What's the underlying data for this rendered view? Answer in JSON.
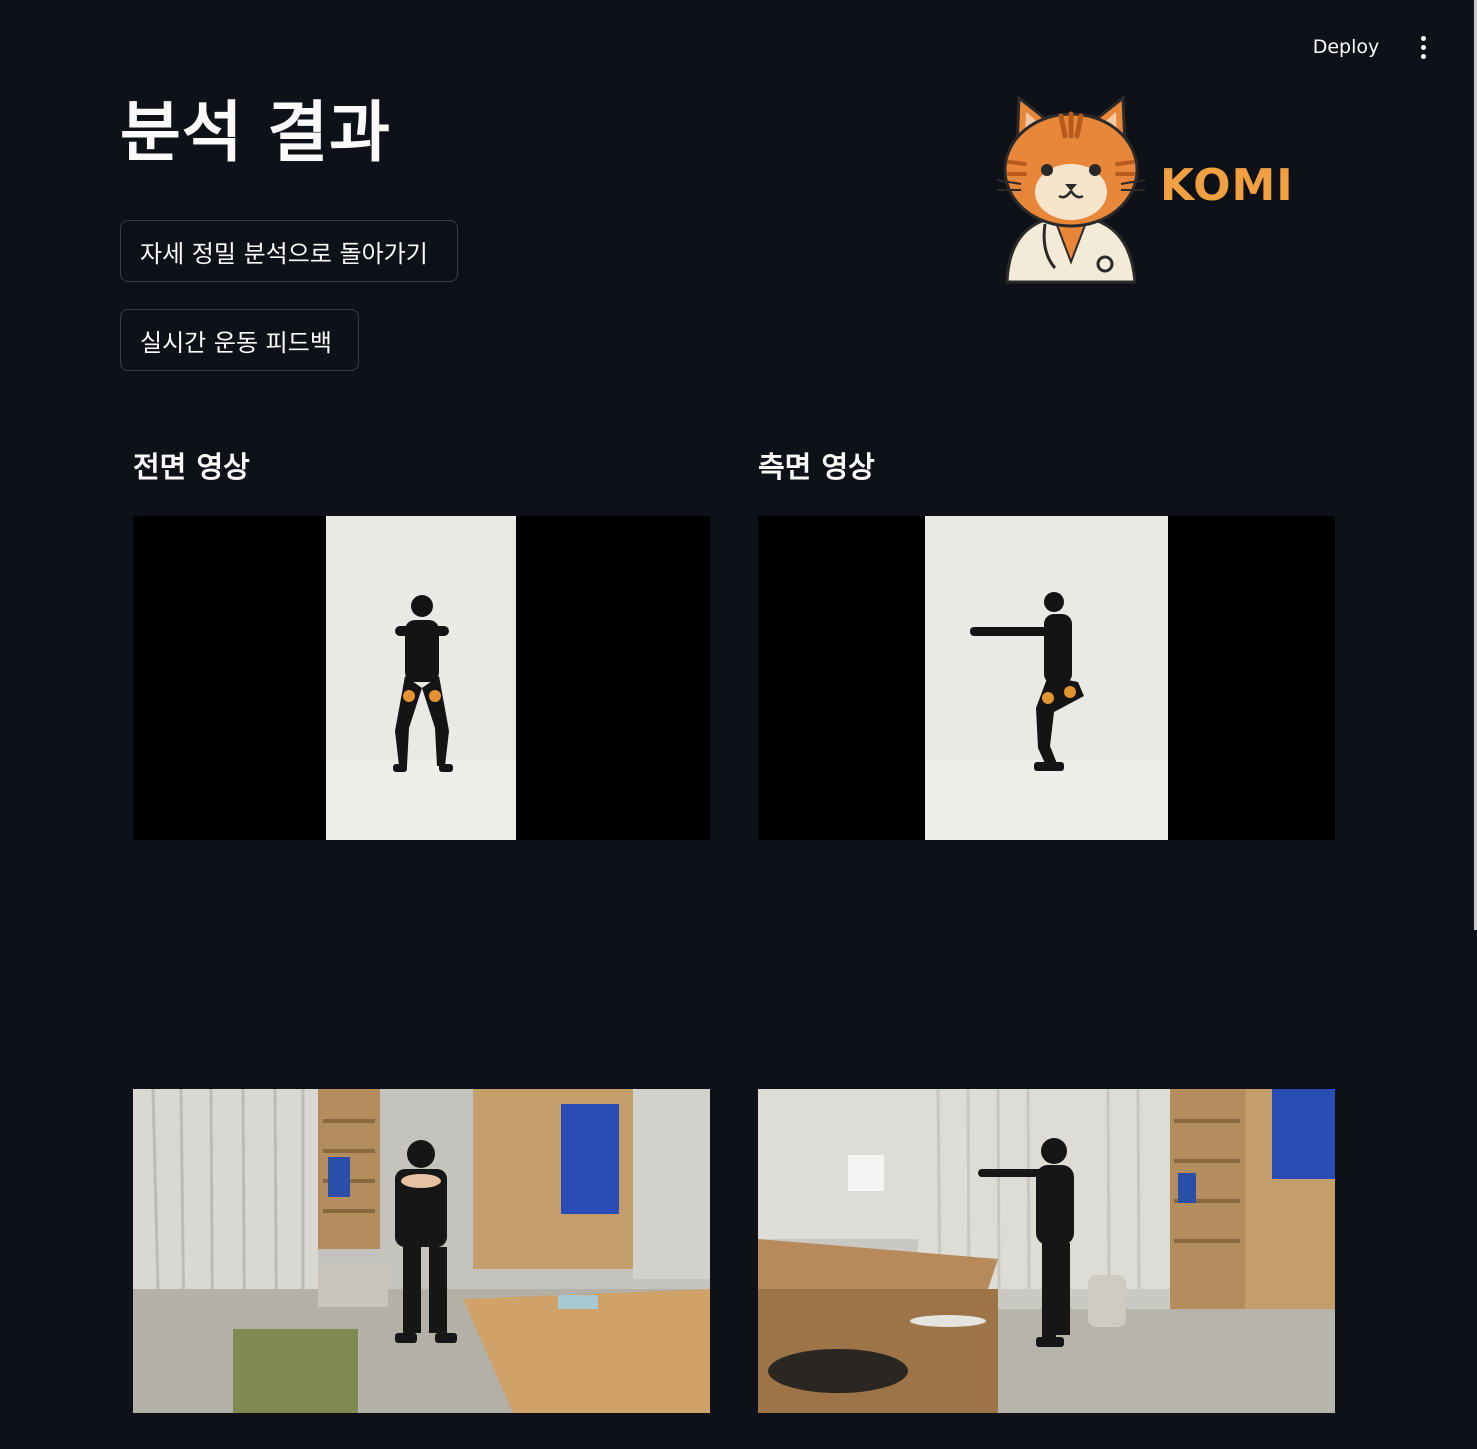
{
  "toolbar": {
    "deploy_label": "Deploy",
    "menu_icon": "kebab-vertical-icon"
  },
  "header": {
    "title": "분석 결과",
    "logo_text": "KOMI",
    "logo_icon": "cat-doctor-logo"
  },
  "buttons": {
    "back_label": "자세 정밀 분석으로 돌아가기",
    "live_label": "실시간 운동 피드백"
  },
  "sections": {
    "front_title": "전면 영상",
    "side_title": "측면 영상"
  },
  "colors": {
    "background": "#0e1117",
    "text": "#fafafa",
    "logo_orange": "#f0a040",
    "button_border": "#3a3d46"
  }
}
